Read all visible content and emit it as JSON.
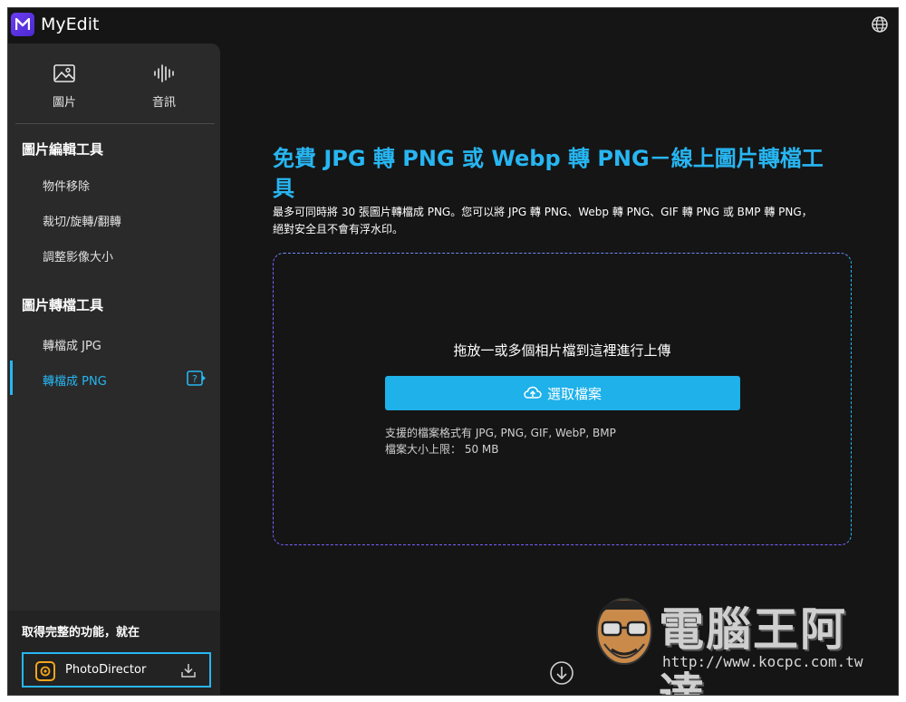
{
  "app": {
    "title": "MyEdit"
  },
  "sidebar": {
    "categories": [
      {
        "label": "圖片",
        "icon": "image-icon"
      },
      {
        "label": "音訊",
        "icon": "audio-wave-icon"
      }
    ],
    "sections": [
      {
        "title": "圖片編輯工具",
        "items": [
          "物件移除",
          "裁切/旋轉/翻轉",
          "調整影像大小"
        ]
      },
      {
        "title": "圖片轉檔工具",
        "items": [
          "轉檔成 JPG",
          "轉檔成 PNG"
        ]
      }
    ],
    "active_item": "轉檔成 PNG",
    "promo": {
      "text": "取得完整的功能，就在",
      "product": "PhotoDirector"
    }
  },
  "main": {
    "heading": "免費 JPG 轉 PNG 或 Webp 轉 PNG－線上圖片轉檔工具",
    "description": "最多可同時將 30 張圖片轉檔成 PNG。您可以將 JPG 轉 PNG、Webp 轉 PNG、GIF 轉 PNG 或 BMP 轉 PNG，絕對安全且不會有浮水印。",
    "dropzone": {
      "title": "拖放一或多個相片檔到這裡進行上傳",
      "button_label": "選取檔案",
      "formats": "支援的檔案格式有 JPG, PNG, GIF, WebP, BMP",
      "size_limit": "檔案大小上限： 50 MB"
    }
  },
  "watermark": {
    "text": "電腦王阿達",
    "url": "http://www.kocpc.com.tw"
  },
  "colors": {
    "accent": "#27b6f2",
    "button": "#1eb1ea",
    "background": "#151515",
    "sidebar": "#2a2a2a"
  }
}
